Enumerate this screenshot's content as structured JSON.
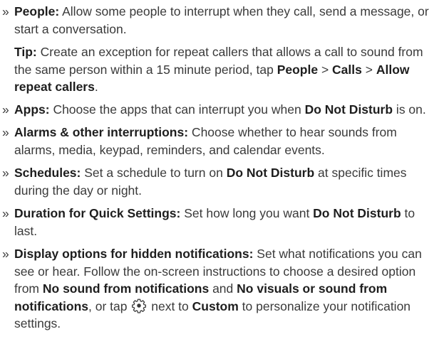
{
  "bullet_glyph": "»",
  "items": [
    {
      "term": "People:",
      "text": " Allow some people to interrupt when they call, send a message, or start a conversation."
    }
  ],
  "tip": {
    "label": "Tip:",
    "text1": " Create an exception for repeat callers that allows a call to sound from the same person within a 15 minute period, tap ",
    "b1": "People",
    "sep1": " > ",
    "b2": "Calls",
    "sep2": " > ",
    "b3": "Allow repeat callers",
    "end": "."
  },
  "apps": {
    "term": "Apps:",
    "text1": " Choose the apps that can interrupt you when ",
    "b1": "Do Not Disturb",
    "text2": " is on."
  },
  "alarms": {
    "term": "Alarms & other interruptions:",
    "text": " Choose whether to hear sounds from alarms, media, keypad, reminders, and calendar events."
  },
  "schedules": {
    "term": "Schedules:",
    "text1": " Set a schedule to turn on ",
    "b1": "Do Not Disturb",
    "text2": " at specific times during the day or night."
  },
  "duration": {
    "term": "Duration for Quick Settings:",
    "text1": " Set how long you want ",
    "b1": "Do Not Disturb",
    "text2": " to last."
  },
  "display": {
    "term": "Display options for hidden notifications:",
    "text1": " Set what notifications you can see or hear. Follow the on-screen instructions to choose a desired option from ",
    "b1": "No sound from notifications",
    "text2": " and ",
    "b2": "No visuals or sound from notifications",
    "text3": ", or tap ",
    "icon": "gear-icon",
    "text4": " next to ",
    "b3": "Custom",
    "text5": " to personalize your notification settings."
  }
}
